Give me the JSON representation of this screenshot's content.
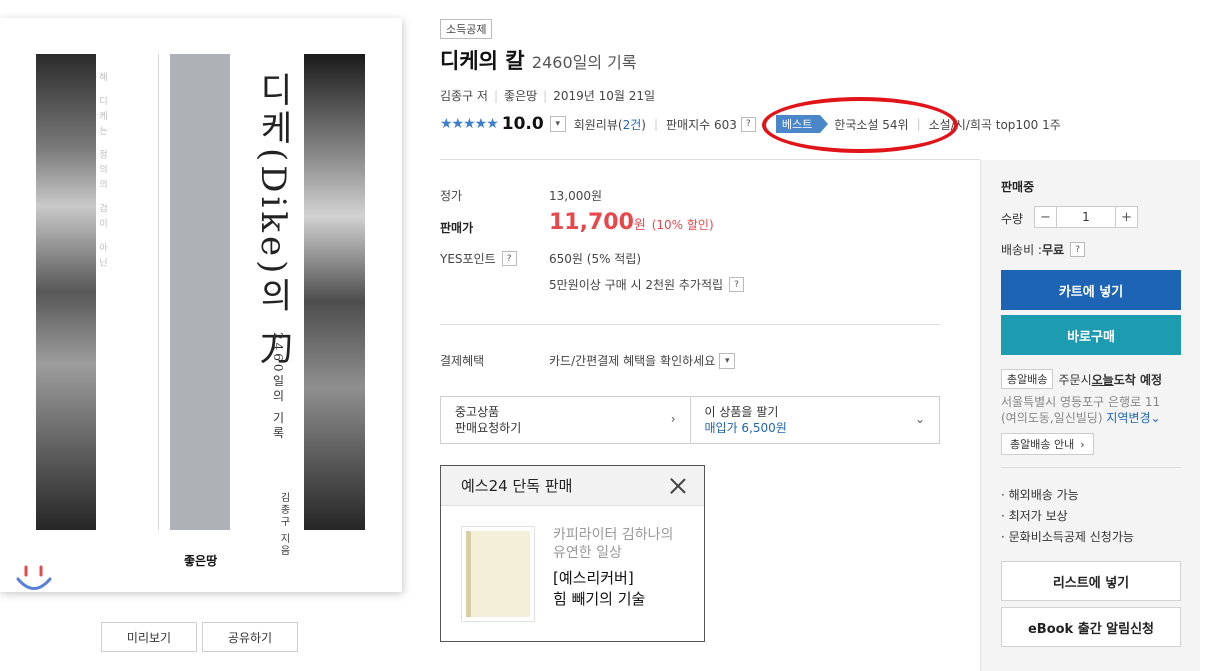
{
  "cover": {
    "title_vertical": "디케(Dike)의 刀",
    "subtitle_vertical": "2460일의 기록",
    "author_vertical": "김종구 지음",
    "side_text": "해 디케는 정의의 검이 아닌",
    "publisher_logo": "좋은땅",
    "logo_icon": "smile-icon"
  },
  "cover_buttons": {
    "preview": "미리보기",
    "share": "공유하기"
  },
  "product": {
    "tag": "소득공제",
    "title": "디케의 칼",
    "subtitle": "2460일의 기록",
    "author": "김종구 저",
    "publisher": "좋은땅",
    "date": "2019년 10월 21일",
    "stars": "★★★★★",
    "score": "10.0",
    "review_prefix": "회원리뷰(",
    "review_count": "2건",
    "review_suffix": ")",
    "sales_index": "판매지수 603",
    "best_label": "베스트",
    "rank1": "한국소설 54위",
    "rank2": "소설/시/희곡 top100 1주"
  },
  "price": {
    "list_label": "정가",
    "list_value": "13,000원",
    "sale_label": "판매가",
    "sale_amount": "11,700",
    "sale_unit": "원",
    "discount": "(10% 할인)",
    "point_label": "YES포인트",
    "point_value": "650원 (5% 적립)",
    "point_extra": "5만원이상 구매 시 2천원 추가적립",
    "benefit_label": "결제혜택",
    "benefit_value": "카드/간편결제 혜택을 확인하세요"
  },
  "used": {
    "left_line1": "중고상품",
    "left_line2": "판매요청하기",
    "right_line1": "이 상품을 팔기",
    "right_line2": "매입가 6,500원"
  },
  "exclusive": {
    "header": "예스24 단독 판매",
    "subtitle_line1": "카피라이터 김하나의",
    "subtitle_line2": "유연한 일상",
    "title_line1": "[예스리커버]",
    "title_line2": "힘 빼기의 기술"
  },
  "side": {
    "status": "판매중",
    "qty_label": "수량",
    "qty_value": "1",
    "qty_minus": "−",
    "qty_plus": "+",
    "shipping_label": "배송비 : ",
    "shipping_value": "무료",
    "cart_button": "카트에 넣기",
    "buy_button": "바로구매",
    "delivery_pill": "총알배송",
    "delivery_text_pre": "주문시 ",
    "delivery_today": "오늘",
    "delivery_text_post": " 도착 예정",
    "address_line1": "서울특별시 영등포구 은행로 11",
    "address_line2": "(여의도동,일신빌딩)",
    "address_change": "지역변경",
    "delivery_info_button": "총알배송 안내",
    "bullets": [
      "해외배송 가능",
      "최저가 보상",
      "문화비소득공제 신청가능"
    ],
    "wishlist_button": "리스트에 넣기",
    "ebook_button": "eBook 출간 알림신청"
  },
  "colors": {
    "accent_blue": "#1e64b4",
    "buy_teal": "#1d9bb0",
    "price_red": "#e8474c",
    "annotation_red": "#e1141a"
  }
}
